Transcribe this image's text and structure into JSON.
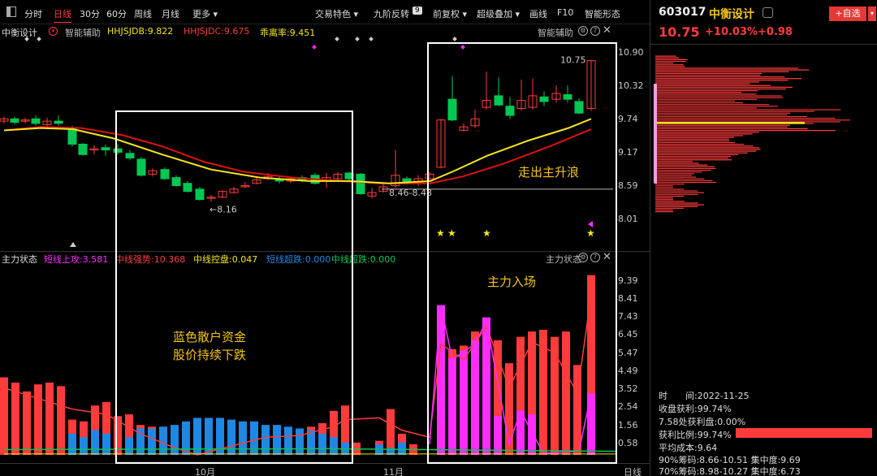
{
  "toolbar": {
    "items": [
      {
        "label": "分时"
      },
      {
        "label": "日线",
        "active": true
      },
      {
        "label": "30分"
      },
      {
        "label": "60分"
      },
      {
        "label": "周线"
      },
      {
        "label": "月线"
      },
      {
        "label": "更多 ▾"
      },
      {
        "label": "交易特色 ▾"
      },
      {
        "label": "九阶反转"
      },
      {
        "label": "前复权 ▾"
      },
      {
        "label": "超级叠加 ▾"
      },
      {
        "label": "画线"
      },
      {
        "label": "F10"
      },
      {
        "label": "智能形态"
      }
    ],
    "nine_badge": "9"
  },
  "indicator_top": {
    "name": "中衡设计",
    "aux": "智能辅助",
    "hhjsjdb": "HHJSJDB:9.822",
    "hhjsjdc": "HHJSJDC:9.675",
    "ratio": "乖离率:9.451",
    "right_label": "智能辅助"
  },
  "price_axis": [
    "10.90",
    "10.32",
    "9.74",
    "9.17",
    "8.59",
    "8.01"
  ],
  "price_annotations": {
    "high": "10.75",
    "low": "←8.16",
    "range": "8.46-8.48"
  },
  "indicator_bottom": {
    "name": "主力状态",
    "s1": "短线上攻:3.581",
    "s2": "中线强势:10.368",
    "s3": "中线控盘:0.047",
    "s4": "短线超跌:0.000",
    "s5": "中线超跌:0.000",
    "right_label": "主力状态"
  },
  "lower_axis": [
    "9.39",
    "8.41",
    "7.43",
    "6.45",
    "5.47",
    "4.49",
    "3.52",
    "2.54",
    "1.56",
    "0.58"
  ],
  "x_axis": {
    "oct": "10月",
    "nov": "11月",
    "period": "日线"
  },
  "annotations": {
    "retail": "蓝色散户资金",
    "retail2": "股价持续下跌",
    "wave": "走出主升浪",
    "main_force": "主力入场"
  },
  "stock": {
    "code": "603017",
    "name": "中衡设计",
    "price": "10.75",
    "pct": "+10.03%",
    "chg": "+0.98",
    "add_label": "+自选"
  },
  "chip": {
    "time_label": "时　　间:2022-11-25",
    "profit": "收盘获利:99.74%",
    "at_price": "7.58处获利盘:0.00%",
    "ratio": "获利比例:99.74%",
    "avg_cost": "平均成本:9.64",
    "c90": "90%筹码:8.66-10.51  集中度:9.69",
    "c70": "70%筹码:8.98-10.27  集中度:6.73",
    "profit_ratio_fraction": 0.9974
  },
  "colors": {
    "up": "#ff3b3b",
    "down": "#00c853",
    "ma_yellow": "#f5e61d",
    "ma_red": "#e01010",
    "blue": "#1e88e5",
    "magenta": "#ff2bff"
  }
}
